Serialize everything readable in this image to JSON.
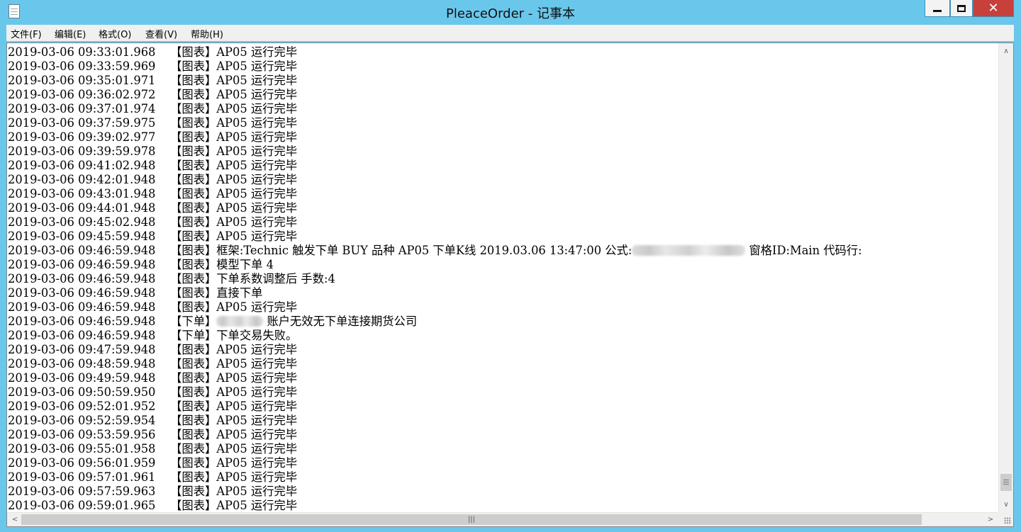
{
  "window": {
    "title": "PleaceOrder - 记事本",
    "controls": {
      "minimize_icon": "minimize-icon",
      "maximize_icon": "maximize-icon",
      "close_glyph": "✕"
    }
  },
  "menu": [
    {
      "label": "文件(F)"
    },
    {
      "label": "编辑(E)"
    },
    {
      "label": "格式(O)"
    },
    {
      "label": "查看(V)"
    },
    {
      "label": "帮助(H)"
    }
  ],
  "log_lines": [
    {
      "time": "2019-03-06 09:33:01.968",
      "tag": "【图表】",
      "msg": "AP05 运行完毕"
    },
    {
      "time": "2019-03-06 09:33:59.969",
      "tag": "【图表】",
      "msg": "AP05 运行完毕"
    },
    {
      "time": "2019-03-06 09:35:01.971",
      "tag": "【图表】",
      "msg": "AP05 运行完毕"
    },
    {
      "time": "2019-03-06 09:36:02.972",
      "tag": "【图表】",
      "msg": "AP05 运行完毕"
    },
    {
      "time": "2019-03-06 09:37:01.974",
      "tag": "【图表】",
      "msg": "AP05 运行完毕"
    },
    {
      "time": "2019-03-06 09:37:59.975",
      "tag": "【图表】",
      "msg": "AP05 运行完毕"
    },
    {
      "time": "2019-03-06 09:39:02.977",
      "tag": "【图表】",
      "msg": "AP05 运行完毕"
    },
    {
      "time": "2019-03-06 09:39:59.978",
      "tag": "【图表】",
      "msg": "AP05 运行完毕"
    },
    {
      "time": "2019-03-06 09:41:02.948",
      "tag": "【图表】",
      "msg": "AP05 运行完毕"
    },
    {
      "time": "2019-03-06 09:42:01.948",
      "tag": "【图表】",
      "msg": "AP05 运行完毕"
    },
    {
      "time": "2019-03-06 09:43:01.948",
      "tag": "【图表】",
      "msg": "AP05 运行完毕"
    },
    {
      "time": "2019-03-06 09:44:01.948",
      "tag": "【图表】",
      "msg": "AP05 运行完毕"
    },
    {
      "time": "2019-03-06 09:45:02.948",
      "tag": "【图表】",
      "msg": "AP05 运行完毕"
    },
    {
      "time": "2019-03-06 09:45:59.948",
      "tag": "【图表】",
      "msg": "AP05 运行完毕"
    },
    {
      "time": "2019-03-06 09:46:59.948",
      "tag": "【图表】",
      "msg": "框架:Technic 触发下单 BUY 品种 AP05 下单K线 2019.03.06 13:47:00 公式:",
      "redacted": "long",
      "msg_after": " 窗格ID:Main 代码行:"
    },
    {
      "time": "2019-03-06 09:46:59.948",
      "tag": "【图表】",
      "msg": "模型下单 4"
    },
    {
      "time": "2019-03-06 09:46:59.948",
      "tag": "【图表】",
      "msg": "下单系数调整后 手数:4"
    },
    {
      "time": "2019-03-06 09:46:59.948",
      "tag": "【图表】",
      "msg": "直接下单"
    },
    {
      "time": "2019-03-06 09:46:59.948",
      "tag": "【图表】",
      "msg": "AP05 运行完毕"
    },
    {
      "time": "2019-03-06 09:46:59.948",
      "tag": "【下单】",
      "msg": "",
      "redacted": "short",
      "msg_after": " 账户无效无下单连接期货公司"
    },
    {
      "time": "2019-03-06 09:46:59.948",
      "tag": "【下单】",
      "msg": "下单交易失败。"
    },
    {
      "time": "2019-03-06 09:47:59.948",
      "tag": "【图表】",
      "msg": "AP05 运行完毕"
    },
    {
      "time": "2019-03-06 09:48:59.948",
      "tag": "【图表】",
      "msg": "AP05 运行完毕"
    },
    {
      "time": "2019-03-06 09:49:59.948",
      "tag": "【图表】",
      "msg": "AP05 运行完毕"
    },
    {
      "time": "2019-03-06 09:50:59.950",
      "tag": "【图表】",
      "msg": "AP05 运行完毕"
    },
    {
      "time": "2019-03-06 09:52:01.952",
      "tag": "【图表】",
      "msg": "AP05 运行完毕"
    },
    {
      "time": "2019-03-06 09:52:59.954",
      "tag": "【图表】",
      "msg": "AP05 运行完毕"
    },
    {
      "time": "2019-03-06 09:53:59.956",
      "tag": "【图表】",
      "msg": "AP05 运行完毕"
    },
    {
      "time": "2019-03-06 09:55:01.958",
      "tag": "【图表】",
      "msg": "AP05 运行完毕"
    },
    {
      "time": "2019-03-06 09:56:01.959",
      "tag": "【图表】",
      "msg": "AP05 运行完毕"
    },
    {
      "time": "2019-03-06 09:57:01.961",
      "tag": "【图表】",
      "msg": "AP05 运行完毕"
    },
    {
      "time": "2019-03-06 09:57:59.963",
      "tag": "【图表】",
      "msg": "AP05 运行完毕"
    },
    {
      "time": "2019-03-06 09:59:01.965",
      "tag": "【图表】",
      "msg": "AP05 运行完毕"
    }
  ],
  "scrollbars": {
    "up_arrow": "∧",
    "down_arrow": "∨",
    "left_arrow": "<",
    "right_arrow": ">",
    "h_thumb_grip": "|||",
    "vertical_position": 1.0,
    "horizontal_position": 0.0
  }
}
